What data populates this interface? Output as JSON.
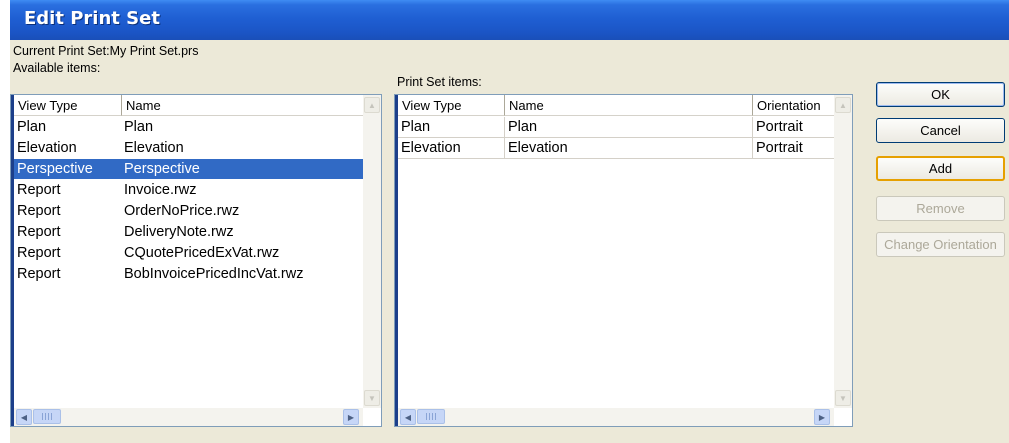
{
  "window": {
    "title": "Edit Print Set"
  },
  "current_print_set": "Current Print Set:My Print Set.prs",
  "available": {
    "label": "Available items:",
    "columns": [
      "View Type",
      "Name"
    ],
    "rows": [
      {
        "type": "Plan",
        "name": "Plan"
      },
      {
        "type": "Elevation",
        "name": "Elevation"
      },
      {
        "type": "Perspective",
        "name": "Perspective"
      },
      {
        "type": "Report",
        "name": "Invoice.rwz"
      },
      {
        "type": "Report",
        "name": "OrderNoPrice.rwz"
      },
      {
        "type": "Report",
        "name": "DeliveryNote.rwz"
      },
      {
        "type": "Report",
        "name": "CQuotePricedExVat.rwz"
      },
      {
        "type": "Report",
        "name": "BobInvoicePricedIncVat.rwz"
      }
    ],
    "selected_index": 2
  },
  "print_set": {
    "label": "Print Set items:",
    "columns": [
      "View Type",
      "Name",
      "Orientation"
    ],
    "rows": [
      {
        "type": "Plan",
        "name": "Plan",
        "orientation": "Portrait"
      },
      {
        "type": "Elevation",
        "name": "Elevation",
        "orientation": "Portrait"
      }
    ]
  },
  "buttons": {
    "ok": "OK",
    "cancel": "Cancel",
    "add": "Add",
    "remove": "Remove",
    "change_orientation": "Change Orientation"
  },
  "colors": {
    "titlebar": "#1f5fd3",
    "selection": "#316ac5",
    "dialog": "#ece9d8"
  },
  "icons": {
    "scroll_up": "chevron-up-icon",
    "scroll_down": "chevron-down-icon",
    "scroll_left": "chevron-left-icon",
    "scroll_right": "chevron-right-icon"
  }
}
